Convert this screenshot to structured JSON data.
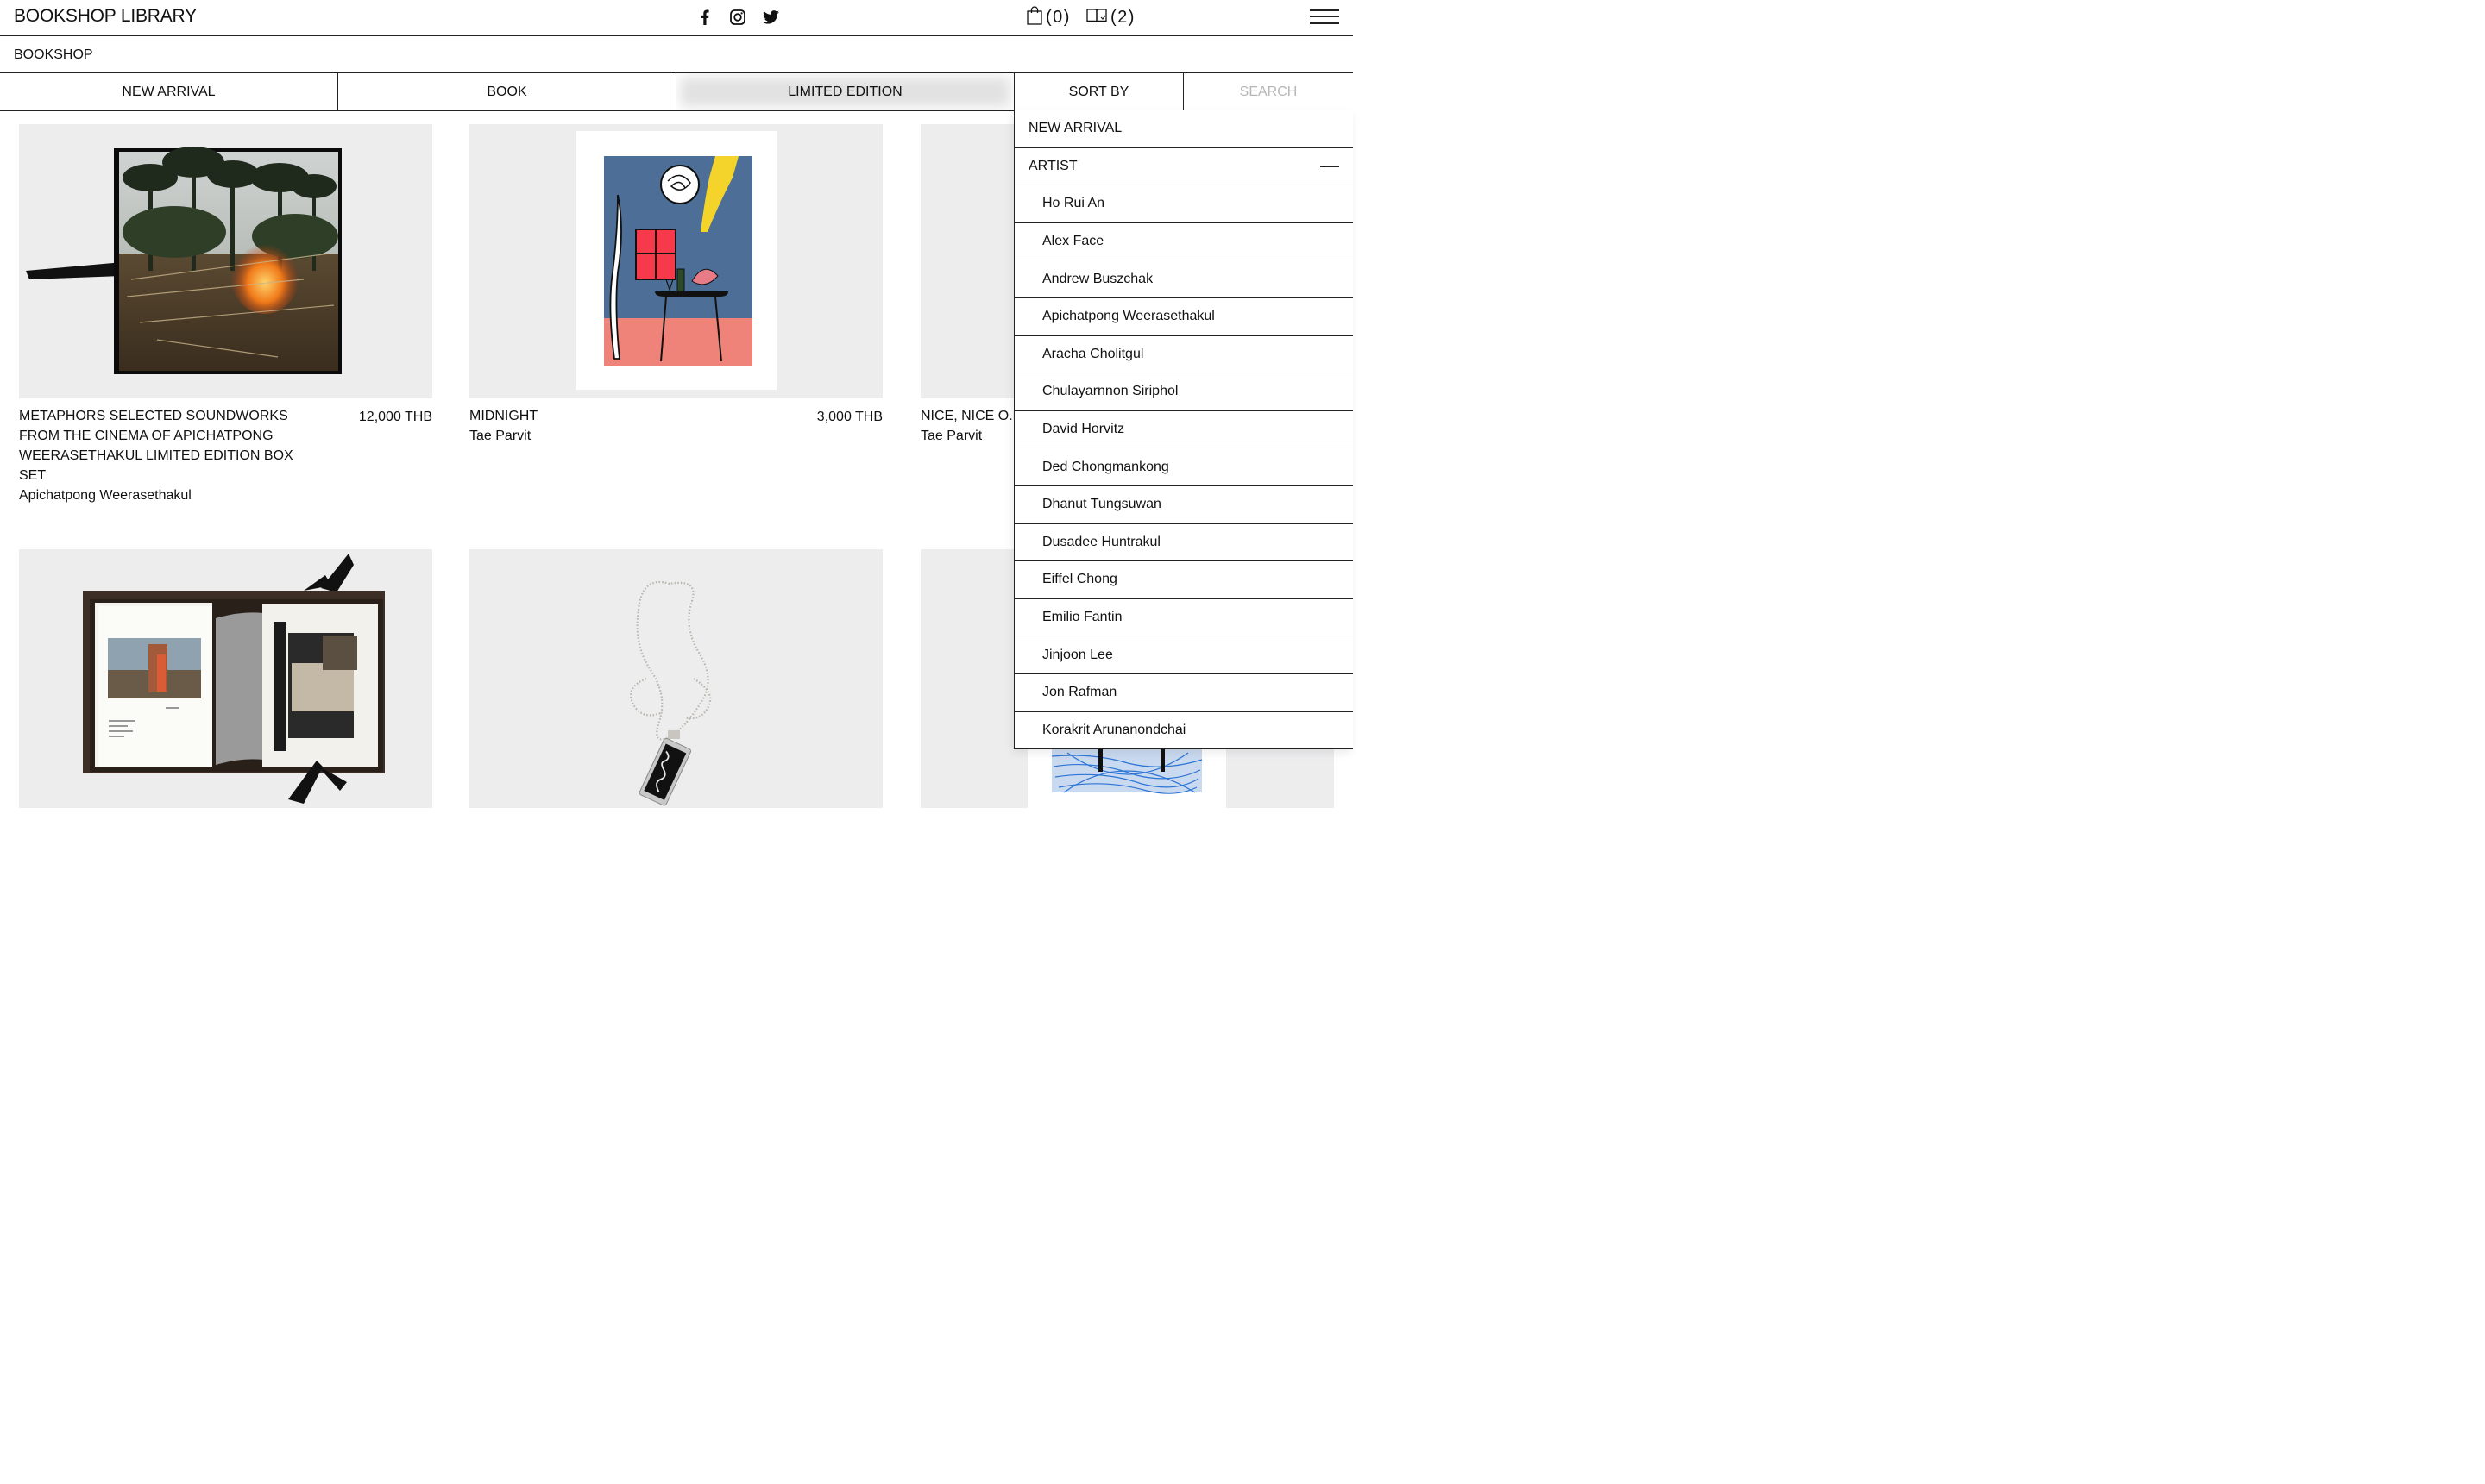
{
  "header": {
    "logo": "BOOKSHOP LIBRARY",
    "cart_count": "(0)",
    "saved_count": "(2)"
  },
  "subheader": {
    "label": "BOOKSHOP"
  },
  "tabs": [
    {
      "label": "NEW ARRIVAL"
    },
    {
      "label": "BOOK"
    },
    {
      "label": "LIMITED EDITION",
      "active": true
    },
    {
      "label": "SORT BY"
    },
    {
      "label": "SEARCH"
    }
  ],
  "products": [
    {
      "title": "METAPHORS SELECTED SOUNDWORKS FROM THE CINEMA OF APICHATPONG WEERASETHAKUL LIMITED EDITION BOX SET",
      "artist": "Apichatpong Weerasethakul",
      "price": "12,000 THB"
    },
    {
      "title": "MIDNIGHT",
      "artist": "Tae Parvit",
      "price": "3,000 THB"
    },
    {
      "title": "NICE, NICE O.K",
      "artist": "Tae Parvit",
      "price": ""
    }
  ],
  "sort_menu": {
    "new_arrival": "NEW ARRIVAL",
    "artist": "ARTIST",
    "artists": [
      "Ho Rui An",
      "Alex Face",
      "Andrew Buszchak",
      "Apichatpong Weerasethakul",
      "Aracha Cholitgul",
      "Chulayarnnon Siriphol",
      "David Horvitz",
      "Ded Chongmankong",
      "Dhanut Tungsuwan",
      "Dusadee Huntrakul",
      "Eiffel Chong",
      "Emilio Fantin",
      "Jinjoon Lee",
      "Jon Rafman",
      "Korakrit Arunanondchai"
    ]
  },
  "icons": [
    "facebook-icon",
    "instagram-icon",
    "twitter-icon",
    "shopping-bag-icon",
    "book-icon",
    "hamburger-menu-icon",
    "collapse-icon"
  ]
}
